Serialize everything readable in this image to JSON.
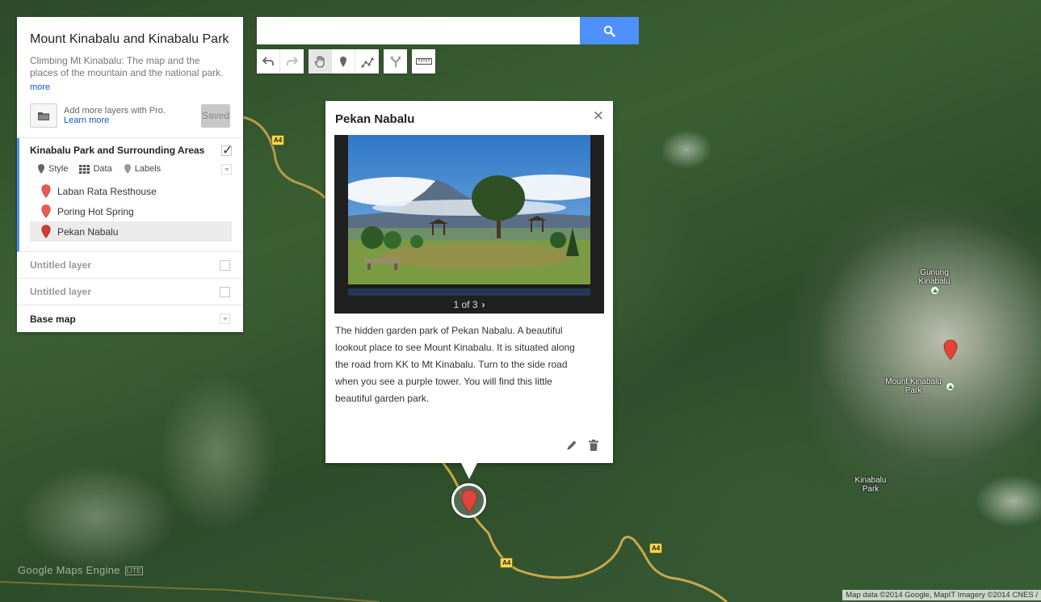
{
  "panel": {
    "title": "Mount Kinabalu and Kinabalu Park",
    "description": "Climbing Mt Kinabalu: The map and the places of the mountain and the national park.",
    "more_label": "more",
    "pro_text": "Add more layers with Pro.",
    "learn_more": "Learn more",
    "saved_label": "Saved",
    "active_layer": {
      "title": "Kinabalu Park and Surrounding Areas",
      "checked": true,
      "tools": {
        "style": "Style",
        "data": "Data",
        "labels": "Labels"
      },
      "places": [
        {
          "label": "Laban Rata Resthouse",
          "selected": false
        },
        {
          "label": "Poring Hot Spring",
          "selected": false
        },
        {
          "label": "Pekan Nabalu",
          "selected": true
        }
      ]
    },
    "other_layers": [
      {
        "label": "Untitled layer"
      },
      {
        "label": "Untitled layer"
      }
    ],
    "base_map_label": "Base map"
  },
  "search": {
    "placeholder": "",
    "value": ""
  },
  "toolbar": {
    "undo": "undo-icon",
    "redo": "redo-icon",
    "pan": "hand-icon",
    "marker": "marker-icon",
    "line": "draw-line-icon",
    "directions": "directions-icon",
    "measure": "ruler-icon"
  },
  "info_window": {
    "title": "Pekan Nabalu",
    "pager": "1 of 3",
    "description": "The hidden garden park of Pekan Nabalu. A beautiful lookout place to see Mount Kinabalu. It is situated along the road from KK to Mt Kinabalu. Turn to the side road when you see a purple tower. You will find this little beautiful garden park."
  },
  "map": {
    "labels": {
      "gunung": "Gunung Kinabalu",
      "mount_park": "Mount Kinabalu Park",
      "kinabalu_park": "Kinabalu Park"
    },
    "road_shields": [
      "A4",
      "A4",
      "A4"
    ],
    "logo": "Google",
    "logo_product": "Maps Engine",
    "logo_badge": "LITE",
    "attribution": "Map data ©2014 Google, MapIT Imagery ©2014 CNES /"
  },
  "colors": {
    "accent": "#4d90fe",
    "pin": "#e2443d",
    "road": "#c9a84a"
  }
}
